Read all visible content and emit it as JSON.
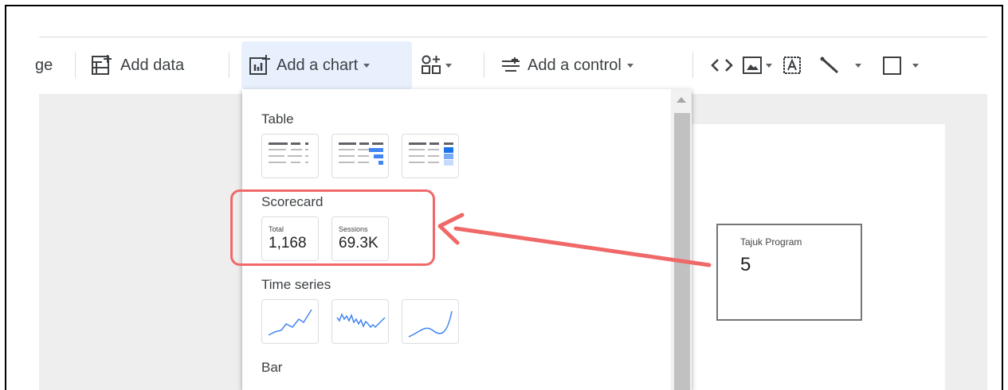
{
  "toolbar": {
    "page_fragment": "ge",
    "add_data": "Add data",
    "add_chart": "Add a chart",
    "add_control": "Add a control"
  },
  "chart_menu": {
    "sections": {
      "table": "Table",
      "scorecard": "Scorecard",
      "time_series": "Time series",
      "bar": "Bar"
    },
    "scorecard_tiles": [
      {
        "label": "Total",
        "value": "1,168"
      },
      {
        "label": "Sessions",
        "value": "69.3K"
      }
    ]
  },
  "canvas": {
    "scorecard_widget": {
      "label": "Tajuk Program",
      "value": "5"
    }
  },
  "colors": {
    "accent_blue": "#4285f4",
    "toolbar_active": "#e8f0fe",
    "highlight_red": "#f06868"
  }
}
